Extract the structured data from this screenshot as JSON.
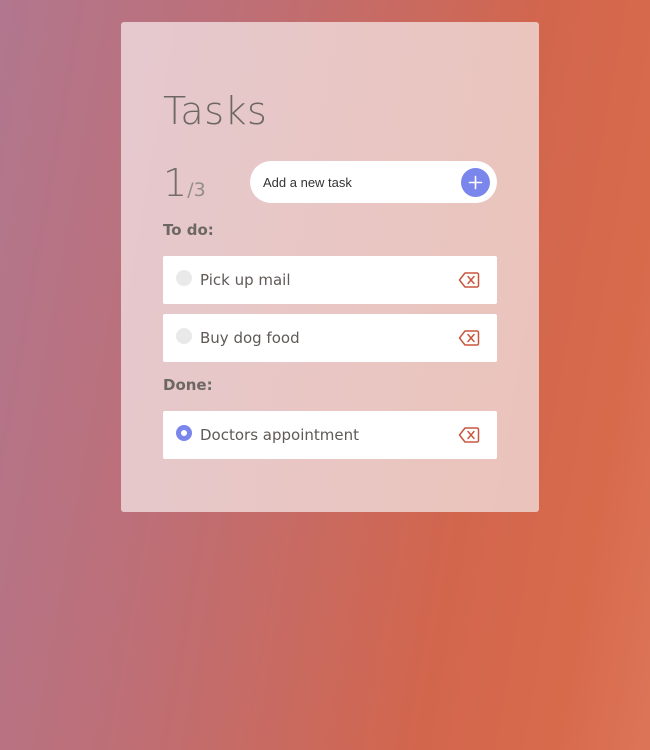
{
  "app": {
    "title": "Tasks"
  },
  "counter": {
    "done": "1",
    "slash": "/",
    "total": "3"
  },
  "add_task": {
    "placeholder": "Add a new task",
    "value": "",
    "button_icon": "plus-icon"
  },
  "todo": {
    "label": "To do:",
    "items": [
      {
        "label": "Pick up mail",
        "completed": false
      },
      {
        "label": "Buy dog food",
        "completed": false
      }
    ]
  },
  "done": {
    "label": "Done:",
    "items": [
      {
        "label": "Doctors appointment",
        "completed": true
      }
    ]
  },
  "icons": {
    "checkbox": "radio-circle-icon",
    "delete": "backspace-delete-icon"
  },
  "colors": {
    "accent": "#7a86ec",
    "delete": "#c8573d",
    "text": "#6d6764"
  }
}
